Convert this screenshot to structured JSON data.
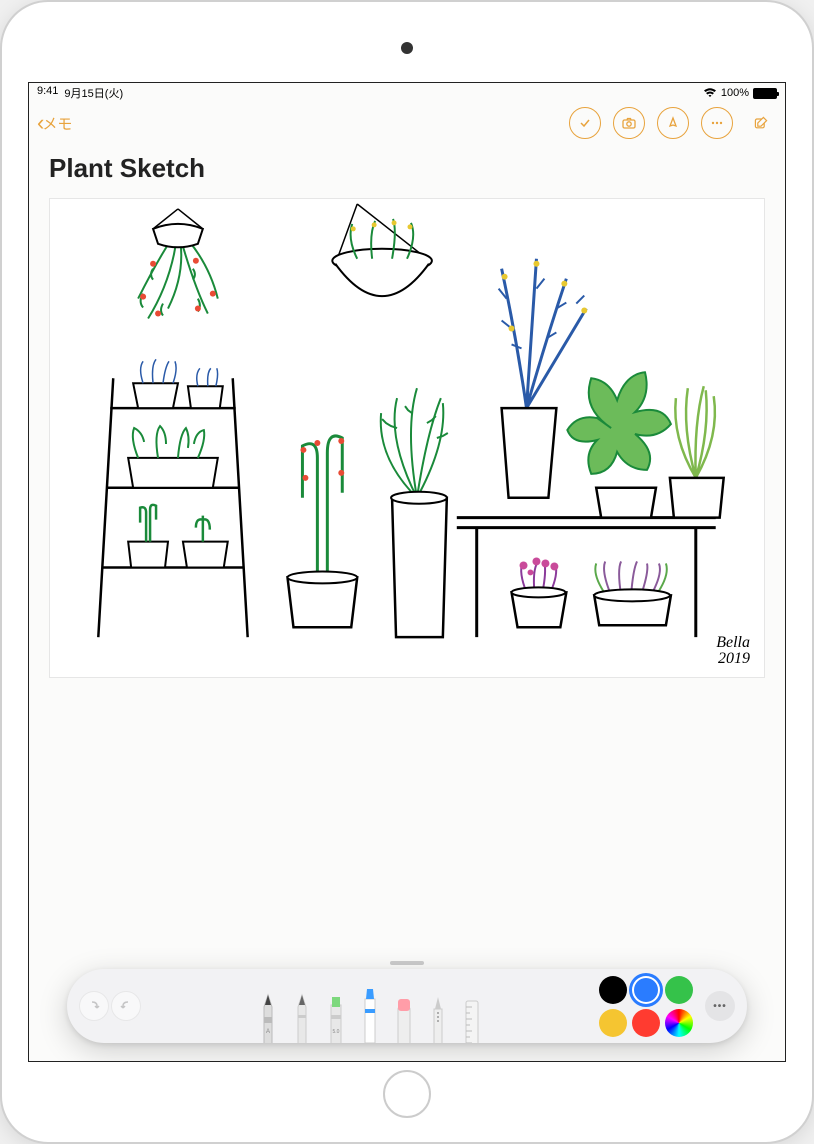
{
  "status_bar": {
    "time": "9:41",
    "date": "9月15日(火)",
    "battery_pct": "100%"
  },
  "nav": {
    "back_label": "メモ",
    "timestamp_faint": ""
  },
  "note": {
    "title": "Plant Sketch",
    "sketch": {
      "signature_name": "Bella",
      "signature_year": "2019"
    }
  },
  "markup": {
    "tools": [
      {
        "name": "pen"
      },
      {
        "name": "pencil"
      },
      {
        "name": "highlighter"
      },
      {
        "name": "marker"
      },
      {
        "name": "eraser"
      },
      {
        "name": "lasso"
      },
      {
        "name": "ruler"
      }
    ],
    "colors": {
      "row1": [
        "#000000",
        "#2a7cff",
        "#35c24a"
      ],
      "row2": [
        "#f5c531",
        "#ff3b30"
      ],
      "selected": "#2a7cff"
    }
  },
  "accent_color": "#e8a33d"
}
